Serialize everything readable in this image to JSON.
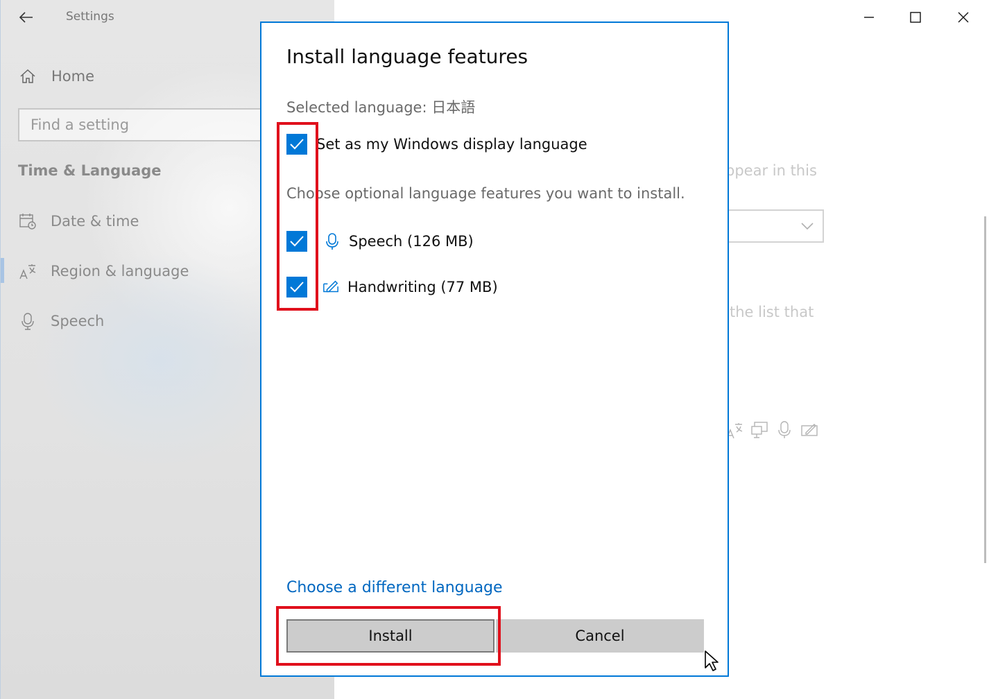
{
  "window": {
    "app_title": "Settings",
    "minimize_icon": "minimize-icon",
    "maximize_icon": "maximize-icon",
    "close_icon": "close-icon"
  },
  "sidebar": {
    "home_label": "Home",
    "search_placeholder": "Find a setting",
    "section_title": "Time & Language",
    "items": [
      {
        "label": "Date & time",
        "icon": "calendar-clock-icon"
      },
      {
        "label": "Region & language",
        "icon": "language-icon"
      },
      {
        "label": "Speech",
        "icon": "microphone-icon"
      }
    ]
  },
  "background": {
    "text1": "ppear in this",
    "text2": "the list that"
  },
  "dialog": {
    "title": "Install language features",
    "selected_language": "Selected language: 日本語",
    "display_language_label": "Set as my Windows display language",
    "optional_text": "Choose optional language features you want to install.",
    "features": [
      {
        "label": "Speech (126 MB)",
        "icon": "microphone-icon",
        "checked": true
      },
      {
        "label": "Handwriting (77 MB)",
        "icon": "pen-icon",
        "checked": true
      }
    ],
    "display_language_checked": true,
    "different_language_link": "Choose a different language",
    "install_label": "Install",
    "cancel_label": "Cancel"
  },
  "colors": {
    "accent": "#0078d7",
    "highlight": "#e0101c"
  }
}
